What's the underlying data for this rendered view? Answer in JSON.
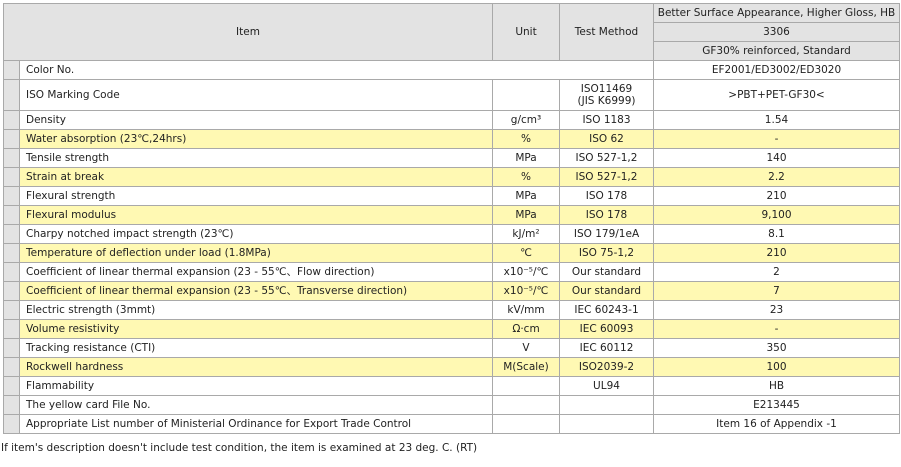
{
  "header": {
    "item": "Item",
    "unit": "Unit",
    "method": "Test Method",
    "grade_title": "Better Surface Appearance, Higher Gloss, HB",
    "grade_code": "3306",
    "grade_desc": "GF30% reinforced, Standard"
  },
  "rows": [
    {
      "item": "Color No.",
      "unit": "",
      "method": "",
      "value": "EF2001/ED3002/ED3020"
    },
    {
      "item": "ISO Marking Code",
      "unit": "",
      "method": "ISO11469",
      "method2": "(JIS K6999)",
      "value": ">PBT+PET-GF30<"
    },
    {
      "item": "Density",
      "unit": "g/cm³",
      "method": "ISO 1183",
      "value": "1.54"
    },
    {
      "item": "Water absorption (23℃,24hrs)",
      "unit": "%",
      "method": "ISO 62",
      "value": "-"
    },
    {
      "item": "Tensile strength",
      "unit": "MPa",
      "method": "ISO 527-1,2",
      "value": "140"
    },
    {
      "item": "Strain at break",
      "unit": "%",
      "method": "ISO 527-1,2",
      "value": "2.2"
    },
    {
      "item": "Flexural strength",
      "unit": "MPa",
      "method": "ISO 178",
      "value": "210"
    },
    {
      "item": "Flexural modulus",
      "unit": "MPa",
      "method": "ISO 178",
      "value": "9,100"
    },
    {
      "item": "Charpy notched impact strength (23℃)",
      "unit": "kJ/m²",
      "method": "ISO 179/1eA",
      "value": "8.1"
    },
    {
      "item": "Temperature of deflection under load (1.8MPa)",
      "unit": "℃",
      "method": "ISO 75-1,2",
      "value": "210"
    },
    {
      "item": "Coefficient of linear thermal expansion (23 - 55℃、Flow direction)",
      "unit": "x10⁻⁵/℃",
      "method": "Our standard",
      "value": "2"
    },
    {
      "item": "Coefficient of linear thermal expansion (23 - 55℃、Transverse direction)",
      "unit": "x10⁻⁵/℃",
      "method": "Our standard",
      "value": "7"
    },
    {
      "item": "Electric strength (3mmt)",
      "unit": "kV/mm",
      "method": "IEC 60243-1",
      "value": "23"
    },
    {
      "item": "Volume resistivity",
      "unit": "Ω·cm",
      "method": "IEC 60093",
      "value": "-"
    },
    {
      "item": "Tracking resistance (CTI)",
      "unit": "V",
      "method": "IEC 60112",
      "value": "350"
    },
    {
      "item": "Rockwell hardness",
      "unit": "M(Scale)",
      "method": "ISO2039-2",
      "value": "100"
    },
    {
      "item": "Flammability",
      "unit": "",
      "method": "UL94",
      "value": "HB"
    },
    {
      "item": "The yellow card File No.",
      "unit": "",
      "method": "",
      "value": "E213445"
    },
    {
      "item": "Appropriate List number of Ministerial Ordinance for Export Trade Control",
      "unit": "",
      "method": "",
      "value": "Item 16 of Appendix -1"
    }
  ],
  "note": "If item's description doesn't include test condition, the item is examined at 23 deg. C. (RT)"
}
